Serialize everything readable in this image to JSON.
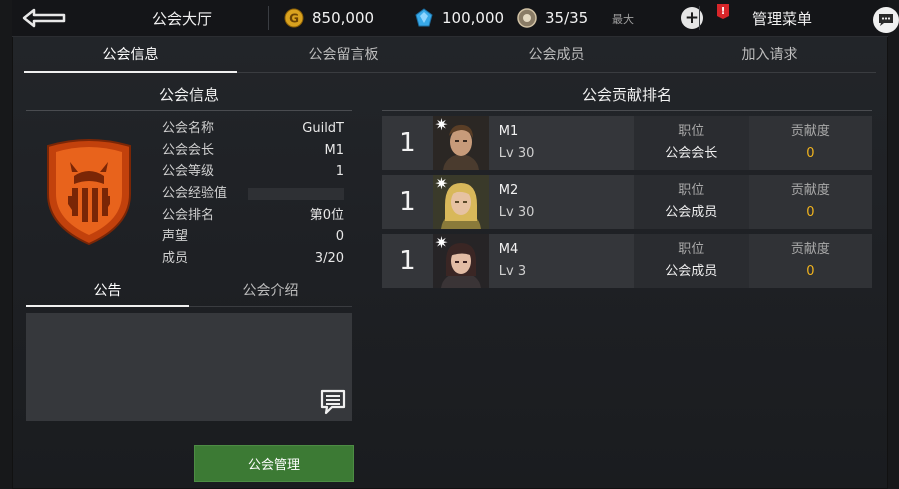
{
  "topbar": {
    "title": "公会大厅",
    "gold": "850,000",
    "gems": "100,000",
    "stamina": "35/35",
    "stamina_max_label": "最大",
    "alert_badge": "!",
    "manage_menu": "管理菜单"
  },
  "tabs": [
    {
      "label": "公会信息",
      "active": true
    },
    {
      "label": "公会留言板",
      "active": false
    },
    {
      "label": "公会成员",
      "active": false
    },
    {
      "label": "加入请求",
      "active": false
    }
  ],
  "guild_info": {
    "header": "公会信息",
    "rows": [
      {
        "key": "公会名称",
        "value": "GuildT"
      },
      {
        "key": "公会会长",
        "value": "M1"
      },
      {
        "key": "公会等级",
        "value": "1"
      },
      {
        "key": "公会经验值",
        "value": ""
      },
      {
        "key": "公会排名",
        "value": "第0位"
      },
      {
        "key": "声望",
        "value": "0"
      },
      {
        "key": "成员",
        "value": "3/20"
      }
    ],
    "emblem_color": "#e8631c",
    "emblem_shield_color": "#c2410c"
  },
  "subtabs": [
    {
      "label": "公告",
      "active": true
    },
    {
      "label": "公会介绍",
      "active": false
    }
  ],
  "manage_button": "公会管理",
  "ranking": {
    "header": "公会贡献排名",
    "role_label": "职位",
    "contrib_label": "贡献度",
    "members": [
      {
        "rank": "1",
        "name": "M1",
        "level": "Lv 30",
        "role": "公会会长",
        "contribution": "0",
        "portrait": "male-knight"
      },
      {
        "rank": "1",
        "name": "M2",
        "level": "Lv 30",
        "role": "公会成员",
        "contribution": "0",
        "portrait": "blonde-female"
      },
      {
        "rank": "1",
        "name": "M4",
        "level": "Lv 3",
        "role": "公会成员",
        "contribution": "0",
        "portrait": "dark-hair-female"
      }
    ]
  },
  "colors": {
    "accent_green": "#3c7a34",
    "contribution_gold": "#f0b31e",
    "alert_red": "#d8262a"
  }
}
